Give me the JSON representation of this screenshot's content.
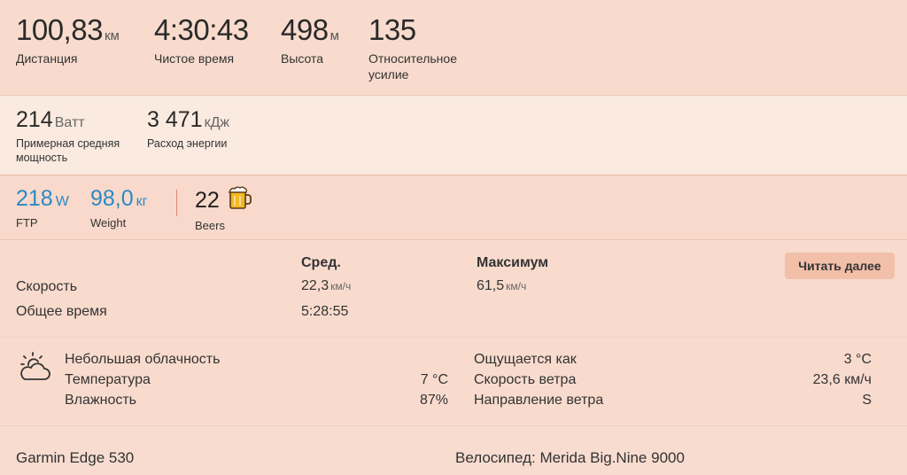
{
  "top_stats": {
    "distance": {
      "value": "100,83",
      "unit": "км",
      "label": "Дистанция"
    },
    "moving_time": {
      "value": "4:30:43",
      "label": "Чистое время"
    },
    "elevation": {
      "value": "498",
      "unit": "м",
      "label": "Высота"
    },
    "relative_effort": {
      "value": "135",
      "label_line1": "Относительное",
      "label_line2": "усилие"
    }
  },
  "power_stats": {
    "avg_power": {
      "value": "214",
      "unit": "Ватт",
      "label_line1": "Примерная средняя",
      "label_line2": "мощность"
    },
    "energy": {
      "value": "3 471",
      "unit": "кДж",
      "label": "Расход энергии"
    }
  },
  "athlete_stats": {
    "ftp": {
      "value": "218",
      "unit": "W",
      "label": "FTP"
    },
    "weight": {
      "value": "98,0",
      "unit": "кг",
      "label": "Weight"
    },
    "beers": {
      "value": "22",
      "label": "Beers",
      "icon": "beer-mug-icon"
    }
  },
  "speed_table": {
    "col_avg": "Сред.",
    "col_max": "Максимум",
    "read_more": "Читать далее",
    "speed": {
      "label": "Скорость",
      "avg": "22,3",
      "avg_unit": "км/ч",
      "max": "61,5",
      "max_unit": "км/ч"
    },
    "elapsed": {
      "label": "Общее время",
      "avg": "5:28:55"
    }
  },
  "weather": {
    "icon": "partly-cloudy-icon",
    "condition": "Небольшая облачность",
    "temperature": {
      "label": "Температура",
      "value": "7 °C"
    },
    "humidity": {
      "label": "Влажность",
      "value": "87%"
    },
    "feels_like": {
      "label": "Ощущается как",
      "value": "3 °C"
    },
    "wind_speed": {
      "label": "Скорость ветра",
      "value": "23,6 км/ч"
    },
    "wind_direction": {
      "label": "Направление ветра",
      "value": "S"
    }
  },
  "footer": {
    "device": "Garmin Edge 530",
    "bike": "Велосипед: Merida Big.Nine 9000"
  },
  "colors": {
    "background": "#f8dbcd",
    "power_row_bg": "#faeadf",
    "accent_blue": "#2b8ac6",
    "button_bg": "#f2bfa9"
  }
}
